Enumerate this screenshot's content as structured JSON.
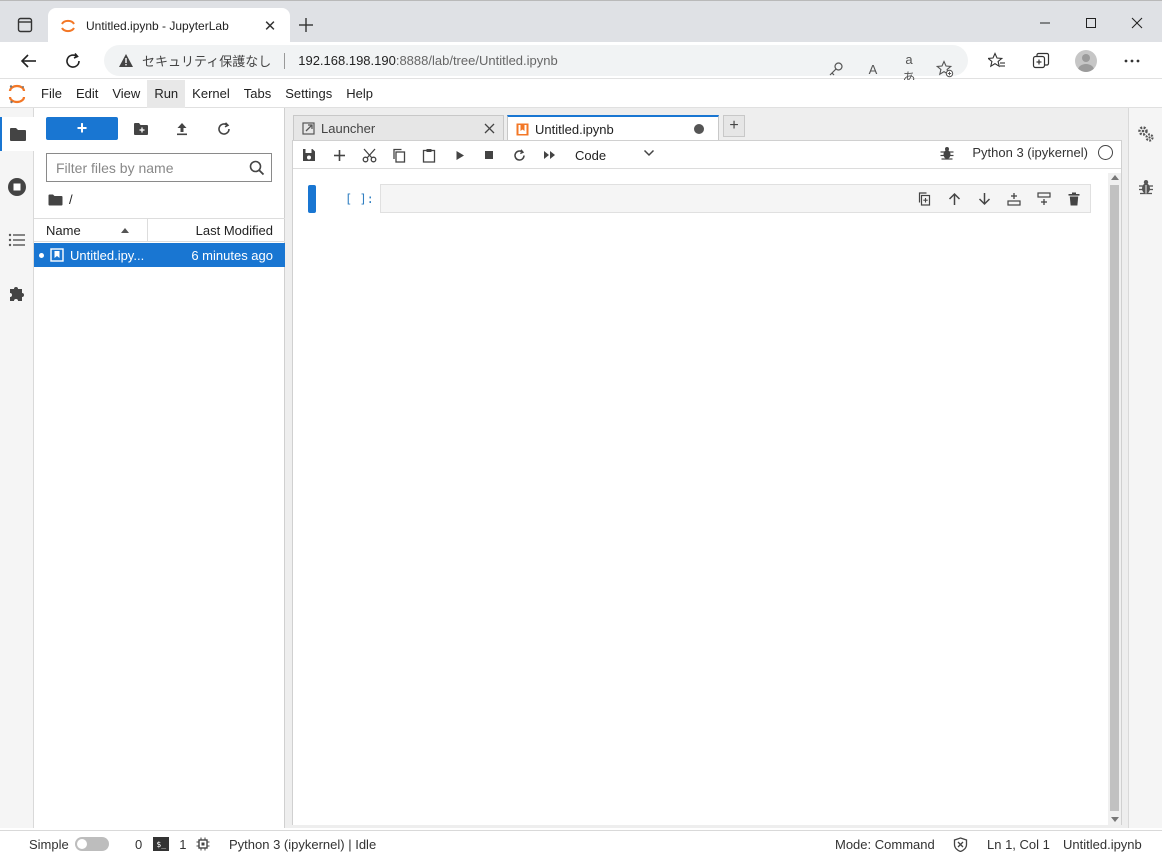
{
  "browser": {
    "tab_title": "Untitled.ipynb - JupyterLab",
    "security_warning": "セキュリティ保護なし",
    "url_host": "192.168.198.190",
    "url_rest": ":8888/lab/tree/Untitled.ipynb",
    "read_aloud_glyph": "A",
    "translate_glyph": "aあ"
  },
  "menubar": {
    "items": [
      "File",
      "Edit",
      "View",
      "Run",
      "Kernel",
      "Tabs",
      "Settings",
      "Help"
    ],
    "active_index": 3
  },
  "filebrowser": {
    "new_button_label": "+",
    "filter_placeholder": "Filter files by name",
    "breadcrumb": "/",
    "col_name": "Name",
    "col_modified": "Last Modified",
    "files": [
      {
        "name": "Untitled.ipy...",
        "modified": "6 minutes ago"
      }
    ]
  },
  "dock": {
    "tabs": [
      {
        "label": "Launcher"
      },
      {
        "label": "Untitled.ipynb"
      }
    ],
    "add_tab_label": "+"
  },
  "notebook": {
    "cell_type": "Code",
    "kernel_name": "Python 3 (ipykernel)",
    "cell_prompt": "[ ]:"
  },
  "statusbar": {
    "mode_toggle_label": "Simple",
    "count_a": "0",
    "terminal_glyph": "$_",
    "count_b": "1",
    "kernel_status": "Python 3 (ipykernel) | Idle",
    "mode": "Mode: Command",
    "cursor_pos": "Ln 1, Col 1",
    "filename": "Untitled.ipynb"
  },
  "colors": {
    "brand_blue": "#1976d2",
    "jupyter_orange": "#f37726"
  }
}
